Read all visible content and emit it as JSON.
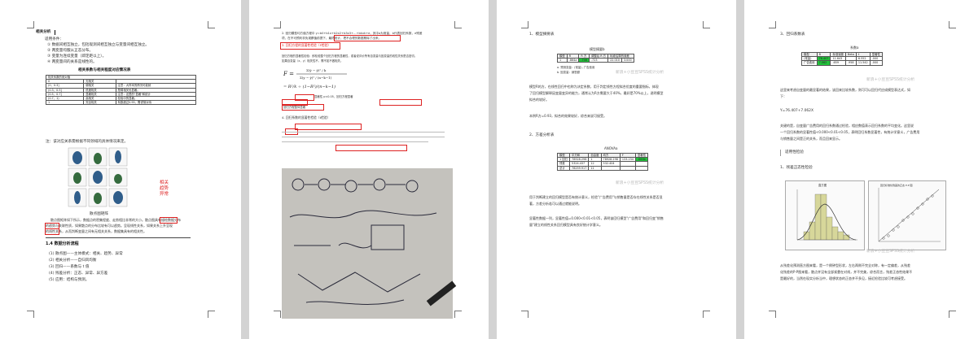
{
  "pages": {
    "p1": {
      "section_heading": "相关分析",
      "intro": "适用条件：",
      "conditions": [
        "① 数据间相互独立，包括观测间相互独立与变量间相互独立。",
        "② 两变量均服从正态分布。",
        "③ 变量为连续变量（即定距以上）。",
        "④ 两变量间的关系是线性的。"
      ],
      "table_title": "相关系数与相关程度对应情况表",
      "table_header": [
        "相关系数的绝对值",
        "",
        ""
      ],
      "table_rows": [
        [
          "0",
          "无相关",
          ""
        ],
        [
          "(0，0.3]",
          "弱相关",
          "注意：大样本的情况可能就"
        ],
        [
          "(0.3，0.5]",
          "低度相关",
          "是弱相关也显著。"
        ],
        [
          "(0.5，0.7]",
          "显著相关",
          "注意：这里的\"显著\"和统计"
        ],
        [
          "(0.7，1)",
          "高相关",
          "检验中的显著。"
        ],
        [
          "1",
          "完全相关",
          "系数超过0.95，需谨慎对待"
        ]
      ],
      "table_note": "注：该对应关系需根据不同领域的具体情况来定。",
      "matrix_caption": "散点图矩阵",
      "red_note": [
        "相关",
        "趋势",
        "异常"
      ],
      "body_lines": [
        "散点图矩阵如下所示，数据点的密集程度、走势相比非常的大小。散点图具有描绘数据分布",
        "的趋势与关联性质，如果散点的分布比较有可以趋势。呈现线性关系，如果关系上升呈现",
        "的线性关系，从而判断变量之间有无相关关系，数据集具有的相关性。"
      ],
      "section_4": "1.4 数据分析流程",
      "steps": [
        "(1)    散点图——主体模式：相关、趋势、异常",
        "(2)    相关分析——自归风均衡",
        "(3)    回归——系数与 t 值",
        "(4)    残差分析：正态、异常、异方差",
        "(5)    应用：结构与预测。"
      ]
    },
    "p2": {
      "lines": [
        "2. 回归模型均方值方程中 y=b0+b1x+b2x2+b3x3+...+bkxk+e，其中a为常量，b代表回归系数，e残差",
        "项，在不可预判非负观察值前提下，最终统计，把不合理的数据剔除了出来。",
        "3. 回归方程的显著性检验（F检验）",
        "回归方程的显著性检验：即检验整个回归方程的显著性，或者说评价所有自变量与因变量的线性关系是否密切。",
        "F = (SSR/k) / (SSE/(n-k-1))"
      ],
      "red_boxes": [
        "如果自变量（x，y）相关性不，需不如不做相关。",
        "3. 回归方程的显著性检验（F检验）",
        "显著性 p<0.05，回归方程显著",
        "回归方程整体显著"
      ],
      "section_4": "4. 回归系数的显著性检验（t检验）",
      "watermark": "新浪+小豆豆SPSS统计分析"
    },
    "p3": {
      "section_1": "1、模型摘要表",
      "table1_title": "模型摘要b",
      "table1_header": [
        "模型",
        "R",
        "R 方",
        "调整后 R 方",
        "标准估算的误差"
      ],
      "table1_row": [
        "1",
        ".864a",
        ".746",
        ".723",
        "22.010",
        "3.000"
      ],
      "table1_notes": [
        "a. 预测变量：(常量), 广告费用",
        "b. 因变量：销售额"
      ],
      "para1": [
        "模型R的方，在线性回归中也称为决定系数，用于判定线性方程拟合优度的重要指标，体现",
        "了回归模型解释因变量变异的能力，通常认为R方需要大于40%，最好是70%以上，说明模型",
        "拟合的较好。"
      ],
      "para2": "本例R方=0.93，拟合的效果较好，综合来说可接受。",
      "section_2": "2、方差分析表",
      "table2_title": "ANOVAa",
      "table2_header": [
        "模型",
        "平方和",
        "自由度",
        "均方",
        "F",
        "显著性"
      ],
      "table2_rows": [
        [
          "1 回归",
          "78928.298",
          "1",
          "78928.298",
          "133.234",
          ".000b"
        ],
        [
          "残差",
          "5324.437",
          "12",
          "532.404",
          "",
          ""
        ],
        [
          "总计",
          "78259.917",
          "11",
          "",
          "",
          ""
        ]
      ],
      "para3": [
        "用于判断建立的回归模型是否有统计意义，检验\"广告费用\"与销售量是否存在线性关系是否显",
        "著，方差分析若可以通过就能说明。"
      ],
      "para4": [
        "显著性数据一列，显著性值=0.000<0.01<0.05，表明该回归模型\"广告费用\"和回归变\"销售",
        "量\"建立的线性关系回归模型具有良好统计学意义。"
      ],
      "watermark": "新浪+小豆豆SPSS统计分析"
    },
    "p4": {
      "section_3": "3、回归系数表",
      "table_title": "系数a",
      "table_header": [
        "模型",
        "B",
        "标准误差",
        "Beta",
        "t",
        "显著性"
      ],
      "table_rows": [
        [
          "(常量)",
          "76.407",
          "11.643",
          "",
          "6.552",
          ".000"
        ],
        [
          "广告费用",
          "7.062",
          ".659",
          ".958",
          "11.542",
          ".000"
        ]
      ],
      "para1": "这里来考虑自变量的最显著的结果，该回来比较系数，则可可以回归代应成模型表达式，如",
      "para1b": "下：",
      "equation": "Y=76.407+7.062X",
      "para2": [
        "关键的是，自变量广告费用的回归系数通过检验，相应数值表示回归系数的平均变化。这里说",
        "一个回归系数的显著性值<0.000<0.01<0.05，表明回归系数显著性，有统计学意义，广告费用",
        "与销售量之间是正的关系，而且回来显示。"
      ],
      "section_check": "适用性检验",
      "sub1": "1、残差正态性检验",
      "hist_title": "直方图",
      "pp_title": "回归标准化残差的正态 P-P 图",
      "para3": [
        "从残差化预测直方图来看，是一个倒钟型形状，左右两侧不完全对称，有一定偏差，从残差",
        "化残差的P-P图来看，散点并没有全部紧靠在对线，并不完美，综合而言，残差正态性结果不",
        "是最好的，当然在现实分析当中，理想状态的正态并不多见，接近检验比较可考虑接受。"
      ],
      "watermark": "新浪+小豆豆SPSS统计分析"
    }
  }
}
